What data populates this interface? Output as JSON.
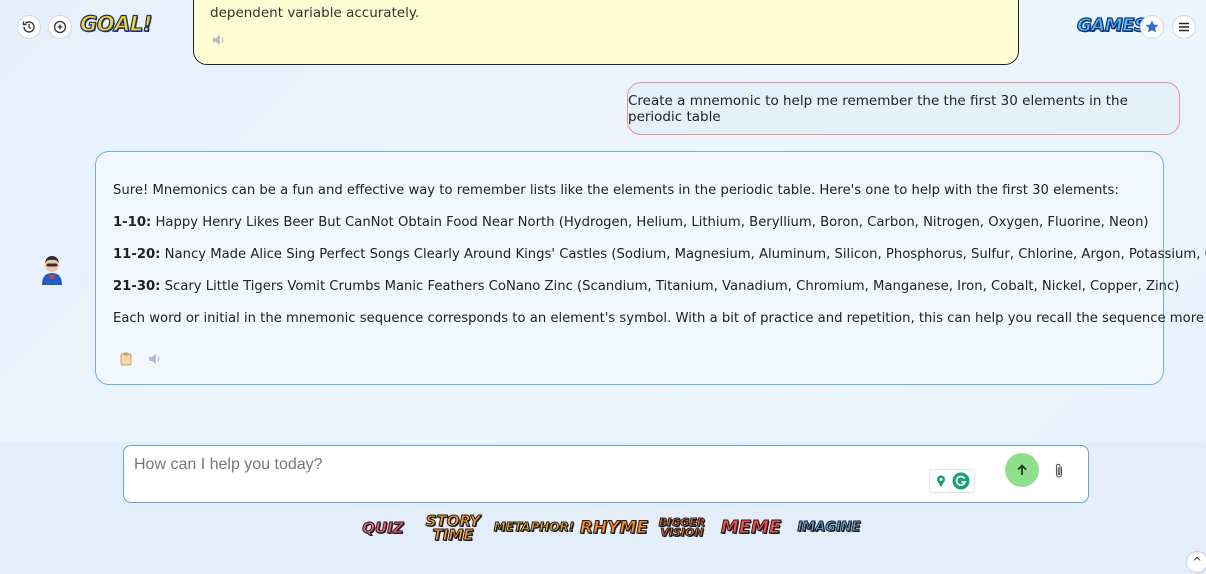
{
  "header": {
    "logo_text": "GOAL!",
    "games_text": "GAMES",
    "icons": [
      "history-icon",
      "new-chat-icon",
      "star-icon",
      "menu-icon"
    ]
  },
  "previous_message": {
    "text": "dependent variable accurately."
  },
  "user_message": {
    "text": "Create a mnemonic to help me remember the the first 30 elements in the periodic table"
  },
  "bot_message": {
    "intro": "Sure! Mnemonics can be a fun and effective way to remember lists like the elements in the periodic table. Here's one to help with the first 30 elements:",
    "lines": [
      {
        "label": "1-10:",
        "text": " Happy Henry Likes Beer But CanNot Obtain Food Near North (Hydrogen, Helium, Lithium, Beryllium, Boron, Carbon, Nitrogen, Oxygen, Fluorine, Neon)"
      },
      {
        "label": "11-20:",
        "text": " Nancy Made Alice Sing Perfect Songs Clearly Around Kings' Castles (Sodium, Magnesium, Aluminum, Silicon, Phosphorus, Sulfur, Chlorine, Argon, Potassium, Calcium)"
      },
      {
        "label": "21-30:",
        "text": " Scary Little Tigers Vomit Crumbs Manic Feathers CoNano Zinc (Scandium, Titanium, Vanadium, Chromium, Manganese, Iron, Cobalt, Nickel, Copper, Zinc)"
      }
    ],
    "outro": "Each word or initial in the mnemonic sequence corresponds to an element's symbol. With a bit of practice and repetition, this can help you recall the sequence more easily."
  },
  "input": {
    "placeholder": "How can I help you today?",
    "value": ""
  },
  "modes": [
    {
      "label": "QUIZ",
      "color": "#ff5b7a"
    },
    {
      "label": "STORY TIME",
      "color": "#ff9a2e"
    },
    {
      "label": "METAPHOR!",
      "color": "#ffb43a"
    },
    {
      "label": "RHYME",
      "color": "#ff8b1e"
    },
    {
      "label": "BIGGER VISION",
      "color": "#ff7a3a"
    },
    {
      "label": "MEME",
      "color": "#ff4a4a"
    },
    {
      "label": "IMAGINE",
      "color": "#5aa8e8"
    }
  ],
  "scroll_top_label": "^"
}
